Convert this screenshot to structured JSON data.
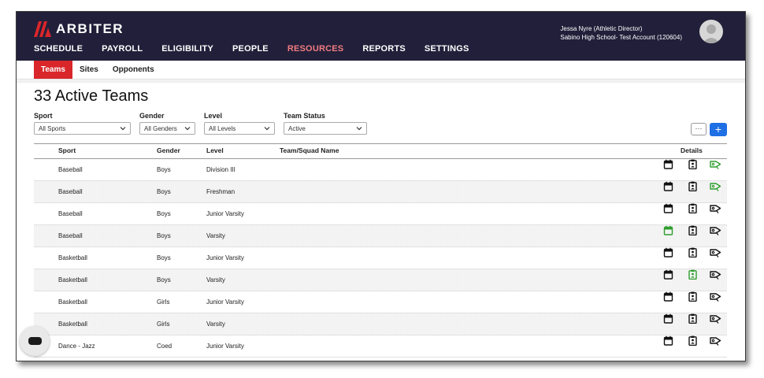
{
  "brand": {
    "name": "ARBITER",
    "color": "#d9262a"
  },
  "nav": {
    "items": [
      "SCHEDULE",
      "PAYROLL",
      "ELIGIBILITY",
      "PEOPLE",
      "RESOURCES",
      "REPORTS",
      "SETTINGS"
    ],
    "active": "RESOURCES"
  },
  "user": {
    "name": "Jessa Nyre (Athletic Director)",
    "org": "Sabino High School- Test Account (120604)"
  },
  "subnav": {
    "tabs": [
      "Teams",
      "Sites",
      "Opponents"
    ],
    "active": "Teams"
  },
  "page": {
    "title": "33 Active Teams"
  },
  "filters": {
    "sport": {
      "label": "Sport",
      "value": "All Sports"
    },
    "gender": {
      "label": "Gender",
      "value": "All Genders"
    },
    "level": {
      "label": "Level",
      "value": "All Levels"
    },
    "status": {
      "label": "Team Status",
      "value": "Active"
    }
  },
  "actions": {
    "more_label": "···",
    "add_label": "+"
  },
  "table": {
    "headers": {
      "sport": "Sport",
      "gender": "Gender",
      "level": "Level",
      "team": "Team/Squad Name",
      "details": "Details"
    },
    "rows": [
      {
        "sport": "Baseball",
        "gender": "Boys",
        "level": "Division III",
        "team": "",
        "calendar_active": false,
        "roster_active": false,
        "tag_active": true
      },
      {
        "sport": "Baseball",
        "gender": "Boys",
        "level": "Freshman",
        "team": "",
        "calendar_active": false,
        "roster_active": false,
        "tag_active": true
      },
      {
        "sport": "Baseball",
        "gender": "Boys",
        "level": "Junior Varsity",
        "team": "",
        "calendar_active": false,
        "roster_active": false,
        "tag_active": false
      },
      {
        "sport": "Baseball",
        "gender": "Boys",
        "level": "Varsity",
        "team": "",
        "calendar_active": true,
        "roster_active": false,
        "tag_active": false
      },
      {
        "sport": "Basketball",
        "gender": "Boys",
        "level": "Junior Varsity",
        "team": "",
        "calendar_active": false,
        "roster_active": false,
        "tag_active": false
      },
      {
        "sport": "Basketball",
        "gender": "Boys",
        "level": "Varsity",
        "team": "",
        "calendar_active": false,
        "roster_active": true,
        "tag_active": false
      },
      {
        "sport": "Basketball",
        "gender": "Girls",
        "level": "Junior Varsity",
        "team": "",
        "calendar_active": false,
        "roster_active": false,
        "tag_active": false
      },
      {
        "sport": "Basketball",
        "gender": "Girls",
        "level": "Varsity",
        "team": "",
        "calendar_active": false,
        "roster_active": false,
        "tag_active": false
      },
      {
        "sport": "Dance - Jazz",
        "gender": "Coed",
        "level": "Junior Varsity",
        "team": "",
        "calendar_active": false,
        "roster_active": false,
        "tag_active": false
      }
    ]
  },
  "colors": {
    "header_bg": "#221f3a",
    "active_nav": "#f07c80",
    "active_tab": "#d9262a",
    "icon_active": "#2e9e2e",
    "icon_default": "#111111",
    "add_button": "#1f6fe5"
  },
  "icons": {
    "details": [
      "calendar-icon",
      "roster-icon",
      "tag-icon"
    ],
    "chat": "chat-icon",
    "dropdown": "chevron-down-icon"
  }
}
